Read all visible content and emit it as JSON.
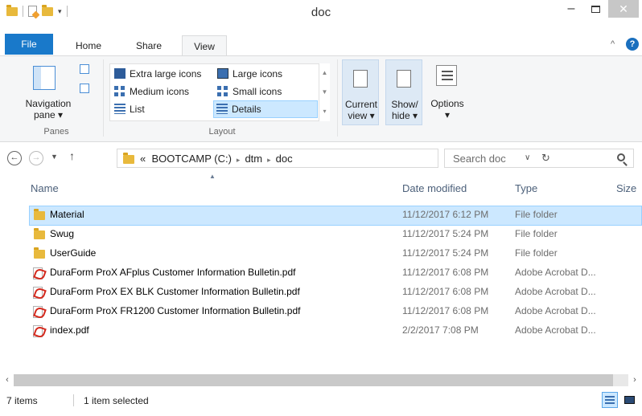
{
  "window": {
    "title": "doc",
    "minimize": "–",
    "close": "✕"
  },
  "ribbon_tabs": [
    {
      "label": "File"
    },
    {
      "label": "Home"
    },
    {
      "label": "Share"
    },
    {
      "label": "View"
    }
  ],
  "ribbon": {
    "panes": {
      "navigation_pane": "Navigation",
      "navigation_pane_2": "pane ▾",
      "group_label": "Panes"
    },
    "layout": {
      "extra_large_icons": "Extra large icons",
      "large_icons": "Large icons",
      "medium_icons": "Medium icons",
      "small_icons": "Small icons",
      "list": "List",
      "details": "Details",
      "group_label": "Layout"
    },
    "current_view": {
      "line1": "Current",
      "line2": "view ▾"
    },
    "show_hide": {
      "line1": "Show/",
      "line2": "hide ▾"
    },
    "options": {
      "label": "Options",
      "dropdown": "▾"
    }
  },
  "address": {
    "overflow": "«",
    "crumbs": [
      "BOOTCAMP (C:)",
      "dtm",
      "doc"
    ],
    "separator": "▸",
    "search_placeholder": "Search doc"
  },
  "columns": {
    "name": "Name",
    "date_modified": "Date modified",
    "type": "Type",
    "size": "Size"
  },
  "files": [
    {
      "name": "Material",
      "date": "11/12/2017 6:12 PM",
      "type": "File folder",
      "icon": "folder-icon",
      "selected": true
    },
    {
      "name": "Swug",
      "date": "11/12/2017 5:24 PM",
      "type": "File folder",
      "icon": "folder-icon",
      "selected": false
    },
    {
      "name": "UserGuide",
      "date": "11/12/2017 5:24 PM",
      "type": "File folder",
      "icon": "folder-icon",
      "selected": false
    },
    {
      "name": "DuraForm ProX AFplus Customer Information Bulletin.pdf",
      "date": "11/12/2017 6:08 PM",
      "type": "Adobe Acrobat D...",
      "icon": "pdf-icon",
      "selected": false
    },
    {
      "name": "DuraForm ProX EX BLK Customer Information Bulletin.pdf",
      "date": "11/12/2017 6:08 PM",
      "type": "Adobe Acrobat D...",
      "icon": "pdf-icon",
      "selected": false
    },
    {
      "name": "DuraForm ProX FR1200 Customer Information Bulletin.pdf",
      "date": "11/12/2017 6:08 PM",
      "type": "Adobe Acrobat D...",
      "icon": "pdf-icon",
      "selected": false
    },
    {
      "name": "index.pdf",
      "date": "2/2/2017 7:08 PM",
      "type": "Adobe Acrobat D...",
      "icon": "pdf-icon",
      "selected": false
    }
  ],
  "status": {
    "item_count": "7 items",
    "selection": "1 item selected"
  },
  "colors": {
    "file_tab": "#1979ca",
    "selection_bg": "#cce8ff",
    "selection_border": "#99d1ff",
    "folder": "#e8b93c"
  }
}
